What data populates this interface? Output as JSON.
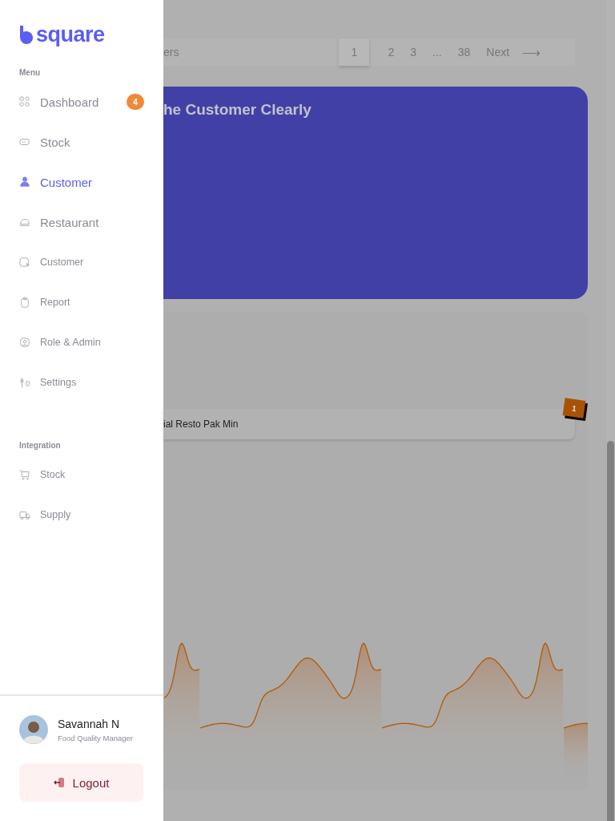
{
  "sidebar": {
    "logo": "square",
    "sections": [
      {
        "label": "Menu",
        "items": [
          {
            "label": "Dashboard",
            "kind": "large",
            "selected": false,
            "badge": "4"
          },
          {
            "label": "Stock",
            "kind": "large",
            "selected": false
          },
          {
            "label": "Customer",
            "kind": "large",
            "selected": true
          },
          {
            "label": "Restaurant",
            "kind": "large",
            "selected": false
          },
          {
            "label": "Customer",
            "kind": "small",
            "selected": false
          },
          {
            "label": "Report",
            "kind": "small",
            "selected": false
          },
          {
            "label": "Role & Admin",
            "kind": "small",
            "selected": false
          },
          {
            "label": "Settings",
            "kind": "small",
            "selected": false
          }
        ]
      },
      {
        "label": "Integration",
        "items": [
          {
            "label": "Stock",
            "kind": "small",
            "selected": false
          },
          {
            "label": "Supply",
            "kind": "small",
            "selected": false
          }
        ]
      }
    ],
    "user": {
      "name": "Savannah N",
      "role": "Food Quality Manager"
    },
    "logout": "Logout"
  },
  "main": {
    "pagination": {
      "label": "ers",
      "pages": [
        {
          "label": "1",
          "selected": true
        },
        {
          "label": "2",
          "selected": false
        },
        {
          "label": "3",
          "selected": false
        },
        {
          "label": "...",
          "selected": false
        },
        {
          "label": "38",
          "selected": false
        }
      ],
      "next": "Next",
      "arrow": "⟶"
    },
    "banner": {
      "title": "he Customer Clearly"
    },
    "card": {
      "row": "ial Resto Pak Min",
      "rank": "1"
    }
  }
}
